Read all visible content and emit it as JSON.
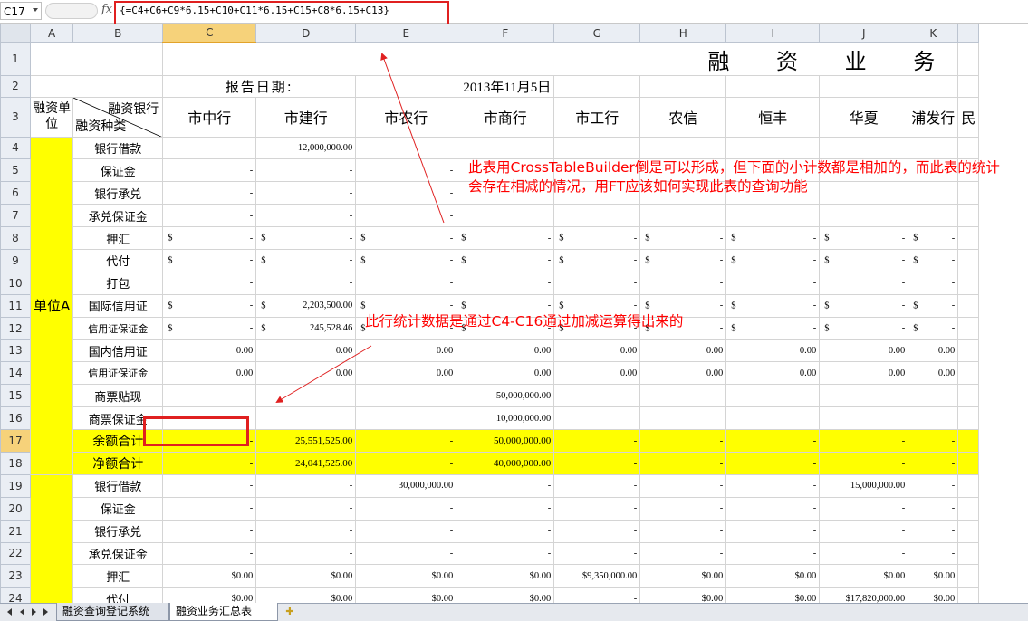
{
  "formula_bar": {
    "name_box": "C17",
    "fx": "fx",
    "formula": "{=C4+C6+C9*6.15+C10+C11*6.15+C15+C8*6.15+C13}"
  },
  "columns": [
    "A",
    "B",
    "C",
    "D",
    "E",
    "F",
    "G",
    "H",
    "I",
    "J",
    "K",
    ""
  ],
  "selected_column": "C",
  "title": "融 资 业 务",
  "report_label": "报告日期:",
  "report_date": "2013年11月5日",
  "header": {
    "unit_label": "融资单位",
    "bank_label": "融资银行",
    "type_label": "融资种类",
    "banks": [
      "市中行",
      "市建行",
      "市农行",
      "市商行",
      "市工行",
      "农信",
      "恒丰",
      "华夏",
      "浦发行",
      "民"
    ]
  },
  "unit_a": "单位A",
  "rows": [
    {
      "n": "4",
      "label": "银行借款",
      "fmt": "num",
      "small": false,
      "cells": [
        "-",
        "12,000,000.00",
        "-",
        "-",
        "-",
        "-",
        "-",
        "-",
        "-",
        ""
      ]
    },
    {
      "n": "5",
      "label": "保证金",
      "fmt": "num",
      "small": false,
      "cells": [
        "-",
        "-",
        "-",
        "",
        "",
        "",
        "",
        "",
        "",
        ""
      ]
    },
    {
      "n": "6",
      "label": "银行承兑",
      "fmt": "num",
      "small": false,
      "cells": [
        "-",
        "-",
        "-",
        "",
        "",
        "",
        "",
        "",
        "",
        ""
      ]
    },
    {
      "n": "7",
      "label": "承兑保证金",
      "fmt": "num",
      "small": false,
      "cells": [
        "-",
        "-",
        "-",
        "",
        "",
        "",
        "",
        "",
        "",
        ""
      ]
    },
    {
      "n": "8",
      "label": "押汇",
      "fmt": "dol",
      "small": false,
      "cells": [
        "-",
        "-",
        "-",
        "-",
        "-",
        "-",
        "-",
        "-",
        "-",
        ""
      ]
    },
    {
      "n": "9",
      "label": "代付",
      "fmt": "dol",
      "small": false,
      "cells": [
        "-",
        "-",
        "-",
        "-",
        "-",
        "-",
        "-",
        "-",
        "-",
        ""
      ]
    },
    {
      "n": "10",
      "label": "打包",
      "fmt": "num",
      "small": false,
      "cells": [
        "-",
        "-",
        "-",
        "-",
        "-",
        "-",
        "-",
        "-",
        "-",
        ""
      ]
    },
    {
      "n": "11",
      "label": "国际信用证",
      "fmt": "dol",
      "small": false,
      "cells": [
        "-",
        "2,203,500.00",
        "-",
        "-",
        "-",
        "-",
        "-",
        "-",
        "-",
        ""
      ]
    },
    {
      "n": "12",
      "label": "信用证保证金",
      "fmt": "dol",
      "small": true,
      "cells": [
        "-",
        "245,528.46",
        "-",
        "-",
        "-",
        "-",
        "-",
        "-",
        "-",
        ""
      ]
    },
    {
      "n": "13",
      "label": "国内信用证",
      "fmt": "num",
      "small": false,
      "cells": [
        "0.00",
        "0.00",
        "0.00",
        "0.00",
        "0.00",
        "0.00",
        "0.00",
        "0.00",
        "0.00",
        ""
      ]
    },
    {
      "n": "14",
      "label": "信用证保证金",
      "fmt": "num",
      "small": true,
      "cells": [
        "0.00",
        "0.00",
        "0.00",
        "0.00",
        "0.00",
        "0.00",
        "0.00",
        "0.00",
        "0.00",
        ""
      ]
    },
    {
      "n": "15",
      "label": "商票贴现",
      "fmt": "num",
      "small": false,
      "cells": [
        "-",
        "-",
        "-",
        "50,000,000.00",
        "-",
        "-",
        "-",
        "-",
        "-",
        ""
      ]
    },
    {
      "n": "16",
      "label": "商票保证金",
      "fmt": "num",
      "small": false,
      "cells": [
        "",
        "",
        "",
        "10,000,000.00",
        "",
        "",
        "",
        "",
        "",
        ""
      ]
    },
    {
      "n": "17",
      "label": "余额合计",
      "fmt": "num",
      "small": false,
      "total": true,
      "cells": [
        "-",
        "25,551,525.00",
        "-",
        "50,000,000.00",
        "-",
        "-",
        "-",
        "-",
        "-",
        ""
      ]
    },
    {
      "n": "18",
      "label": "净额合计",
      "fmt": "num",
      "small": false,
      "total": true,
      "cells": [
        "-",
        "24,041,525.00",
        "-",
        "40,000,000.00",
        "-",
        "-",
        "-",
        "-",
        "-",
        ""
      ]
    },
    {
      "n": "19",
      "label": "银行借款",
      "fmt": "num",
      "small": false,
      "cells": [
        "-",
        "-",
        "30,000,000.00",
        "-",
        "-",
        "-",
        "-",
        "15,000,000.00",
        "-",
        ""
      ]
    },
    {
      "n": "20",
      "label": "保证金",
      "fmt": "num",
      "small": false,
      "cells": [
        "-",
        "-",
        "-",
        "-",
        "-",
        "-",
        "-",
        "-",
        "-",
        ""
      ]
    },
    {
      "n": "21",
      "label": "银行承兑",
      "fmt": "num",
      "small": false,
      "cells": [
        "-",
        "-",
        "-",
        "-",
        "-",
        "-",
        "-",
        "-",
        "-",
        ""
      ]
    },
    {
      "n": "22",
      "label": "承兑保证金",
      "fmt": "num",
      "small": false,
      "cells": [
        "-",
        "-",
        "-",
        "-",
        "-",
        "-",
        "-",
        "-",
        "-",
        ""
      ]
    },
    {
      "n": "23",
      "label": "押汇",
      "fmt": "num",
      "small": false,
      "cells": [
        "$0.00",
        "$0.00",
        "$0.00",
        "$0.00",
        "$9,350,000.00",
        "$0.00",
        "$0.00",
        "$0.00",
        "$0.00",
        ""
      ]
    },
    {
      "n": "24",
      "label": "代付",
      "fmt": "num",
      "small": false,
      "cells": [
        "$0.00",
        "$0.00",
        "$0.00",
        "$0.00",
        "-",
        "$0.00",
        "$0.00",
        "$17,820,000.00",
        "$0.00",
        ""
      ]
    }
  ],
  "annotations": {
    "note1": "此表用CrossTableBuilder倒是可以形成，但下面的小计数都是相加的，而此表的统计会存在相减的情况，用FT应该如何实现此表的查询功能",
    "note2": "此行统计数据是通过C4-C16通过加减运算得出来的"
  },
  "tabs": [
    "融资查询登记系统",
    "融资业务汇总表"
  ],
  "active_tab": 1,
  "colors": {
    "highlight": "#ffff00",
    "annotation": "#ff0000",
    "selected_header": "#f6d27a"
  }
}
